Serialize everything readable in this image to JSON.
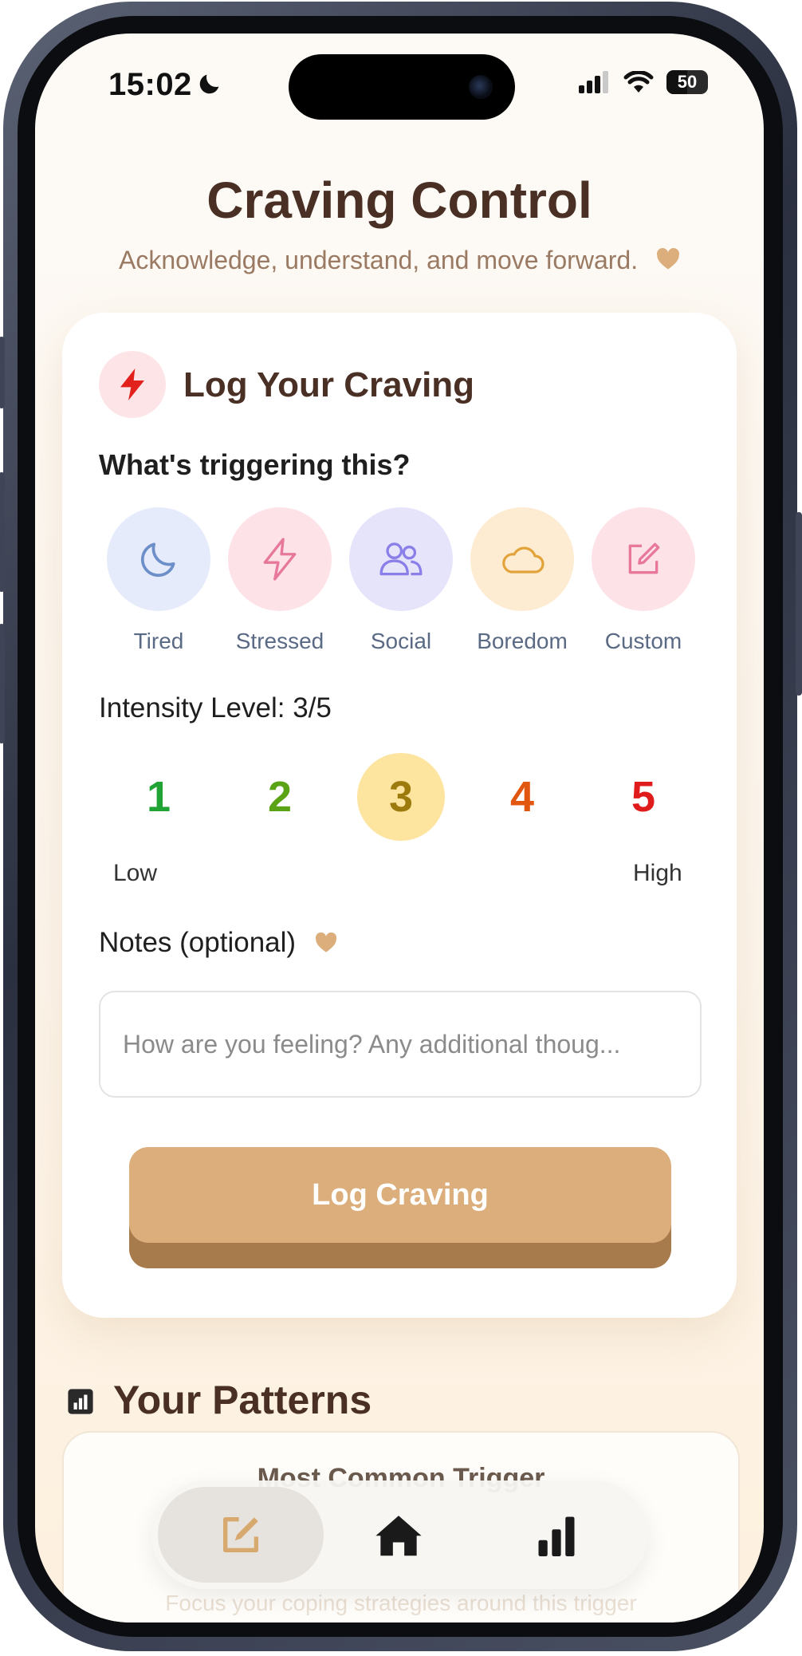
{
  "status_bar": {
    "time": "15:02",
    "battery": "50"
  },
  "header": {
    "title": "Craving Control",
    "subtitle": "Acknowledge, understand, and move forward."
  },
  "log_card": {
    "title": "Log Your Craving",
    "trigger_question": "What's triggering this?",
    "triggers": [
      {
        "label": "Tired",
        "icon": "moon-icon",
        "color": "#6d8fc9",
        "bg": "#e5ebfb"
      },
      {
        "label": "Stressed",
        "icon": "lightning-icon",
        "color": "#e8789b",
        "bg": "#fde2e8"
      },
      {
        "label": "Social",
        "icon": "people-icon",
        "color": "#8a7ee8",
        "bg": "#e5e4fb"
      },
      {
        "label": "Boredom",
        "icon": "cloud-icon",
        "color": "#e2a33a",
        "bg": "#fdebd2"
      },
      {
        "label": "Custom",
        "icon": "edit-icon",
        "color": "#e8789b",
        "bg": "#fde2e8"
      }
    ],
    "intensity_label": "Intensity Level: 3/5",
    "intensity_selected": 3,
    "levels": [
      {
        "value": "1",
        "color": "#22a335"
      },
      {
        "value": "2",
        "color": "#5aa315"
      },
      {
        "value": "3",
        "color": "#9d7a0c"
      },
      {
        "value": "4",
        "color": "#e2570f"
      },
      {
        "value": "5",
        "color": "#e01b1b"
      }
    ],
    "low_label": "Low",
    "high_label": "High",
    "notes_label": "Notes (optional)",
    "notes_placeholder": "How are you feeling? Any additional thoug...",
    "submit_label": "Log Craving"
  },
  "patterns": {
    "title": "Your Patterns",
    "card_title": "Most Common Trigger",
    "card_subtitle": "Focus your coping strategies around this trigger"
  },
  "nav": {
    "items": [
      "log-icon",
      "home-icon",
      "stats-icon"
    ],
    "active": 0
  },
  "colors": {
    "accent": "#dcae7c",
    "title": "#4a3024",
    "heart": "#dcae7c"
  }
}
